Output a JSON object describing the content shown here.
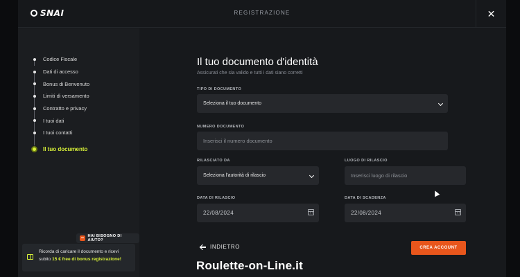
{
  "header": {
    "logo_text": "SNAI",
    "title": "REGISTRAZIONE",
    "close_glyph": "✕"
  },
  "sidebar": {
    "steps": [
      {
        "label": "Codice Fiscale"
      },
      {
        "label": "Dati di accesso"
      },
      {
        "label": "Bonus di Benvenuto"
      },
      {
        "label": "Limiti di versamento"
      },
      {
        "label": "Contratto e privacy"
      },
      {
        "label": "I tuoi dati"
      },
      {
        "label": "I tuoi contatti"
      },
      {
        "label": "Il tuo documento",
        "active": true
      }
    ],
    "help_label": "HAI BISOGNO DI AIUTO?",
    "promo": {
      "text_before": "Ricorda di caricare il documento e ricevi subito",
      "highlight": "15 € free di bonus registrazione!"
    }
  },
  "form": {
    "title": "Il tuo documento d'identità",
    "subtitle": "Assicurati che sia valido e tutti i dati siano corretti",
    "doc_type": {
      "label": "TIPO DI DOCUMENTO",
      "value": "Seleziona il tuo documento"
    },
    "doc_number": {
      "label": "NUMERO DOCUMENTO",
      "placeholder": "Inserisci il numero documento"
    },
    "issued_by": {
      "label": "RILASCIATO DA",
      "value": "Seleziona l'autorità di rilascio"
    },
    "issue_place": {
      "label": "LUOGO DI RILASCIO",
      "placeholder": "Inserisci luogo di rilascio"
    },
    "issue_date": {
      "label": "DATA DI RILASCIO",
      "value": "22/08/2024"
    },
    "expiry_date": {
      "label": "DATA DI SCADENZA",
      "value": "22/08/2024"
    },
    "back_label": "INDIETRO",
    "create_label": "CREA ACCOUNT"
  },
  "watermark": "Roulette-on-Line.it",
  "colors": {
    "accent_green": "#d9f238",
    "accent_orange": "#e8561c",
    "panel": "#1b1d20",
    "field": "#26282c"
  },
  "icons": [
    "snai-logo-icon",
    "close-icon",
    "chevron-down-icon",
    "calendar-icon",
    "arrow-left-icon",
    "help-chat-icon",
    "gift-icon"
  ]
}
